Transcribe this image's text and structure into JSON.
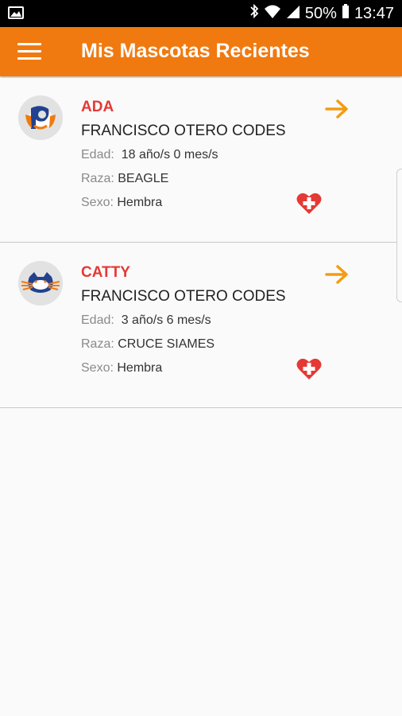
{
  "status_bar": {
    "battery": "50%",
    "time": "13:47"
  },
  "app_bar": {
    "title": "Mis Mascotas Recientes"
  },
  "colors": {
    "brand": "#f07a10",
    "name_red": "#e53935",
    "arrow_orange": "#f39c12",
    "heart_red": "#e53935"
  },
  "pets": [
    {
      "name": "ADA",
      "owner": "FRANCISCO OTERO CODES",
      "age_label": "Edad:",
      "age": "18 año/s 0 mes/s",
      "breed_label": "Raza:",
      "breed": "BEAGLE",
      "sex_label": "Sexo:",
      "sex": "Hembra",
      "avatar_icon": "dog-avatar-icon"
    },
    {
      "name": "CATTY",
      "owner": "FRANCISCO OTERO CODES",
      "age_label": "Edad:",
      "age": "3 año/s 6 mes/s",
      "breed_label": "Raza:",
      "breed": "CRUCE SIAMES",
      "sex_label": "Sexo:",
      "sex": "Hembra",
      "avatar_icon": "cat-avatar-icon"
    }
  ]
}
